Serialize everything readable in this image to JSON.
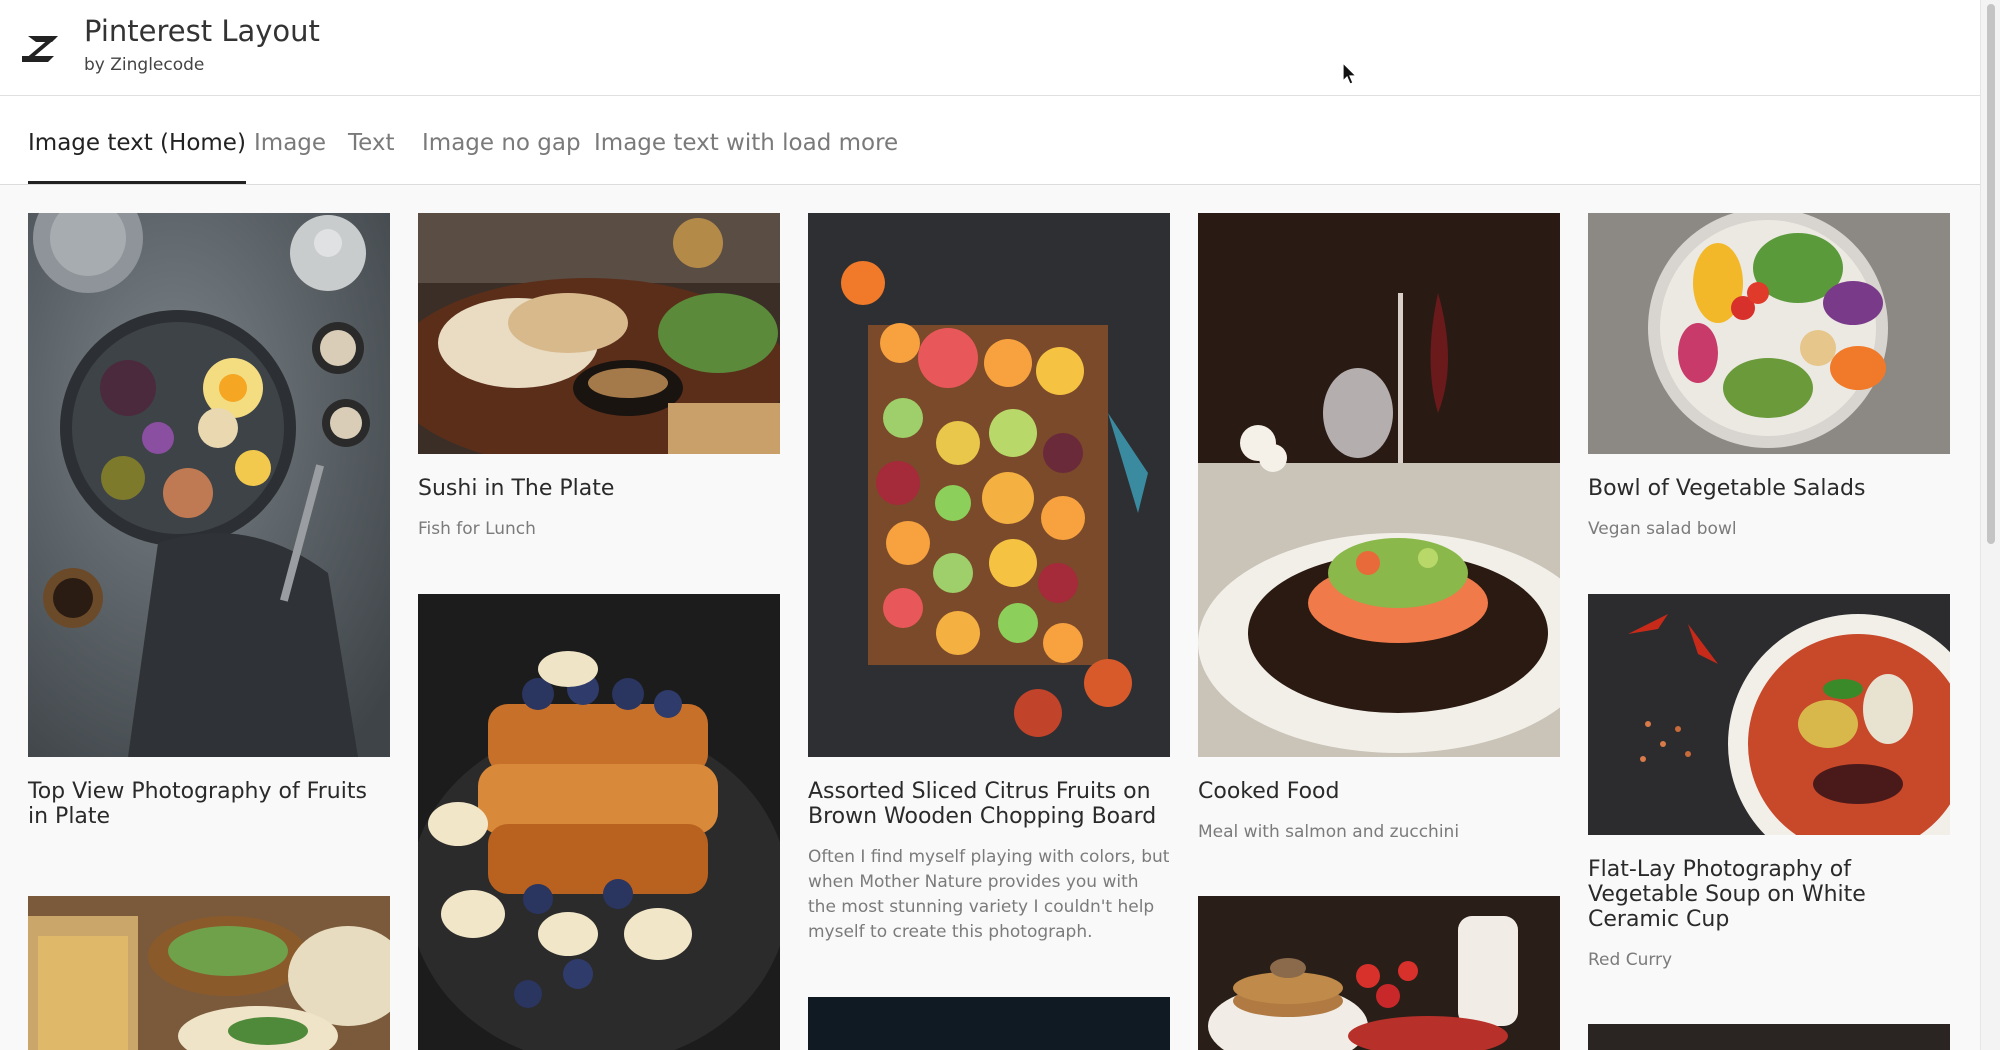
{
  "header": {
    "title": "Pinterest Layout",
    "subtitle": "by Zinglecode",
    "logo_icon": "zinglecode-logo"
  },
  "tabs": [
    {
      "label": "Image text (Home)",
      "active": true
    },
    {
      "label": "Image",
      "active": false
    },
    {
      "label": "Text",
      "active": false
    },
    {
      "label": "Image no gap",
      "active": false
    },
    {
      "label": "Image text with load more",
      "active": false
    }
  ],
  "cards": [
    {
      "title": "Top View Photography of Fruits in Plate",
      "subtitle": ""
    },
    {
      "title": "Sushi in The Plate",
      "subtitle": "Fish for Lunch"
    },
    {
      "title": "Assorted Sliced Citrus Fruits on Brown Wooden Chopping Board",
      "subtitle": "Often I find myself playing with colors, but when Mother Nature provides you with the most stunning variety I couldn't help myself to create this photograph."
    },
    {
      "title": "Cooked Food",
      "subtitle": "Meal with salmon and zucchini"
    },
    {
      "title": "Bowl of Vegetable Salads",
      "subtitle": "Vegan salad bowl"
    },
    {
      "title": "Flat-Lay Photography of Vegetable Soup on White Ceramic Cup",
      "subtitle": "Red Curry"
    }
  ],
  "colors": {
    "accent": "#222222",
    "tab_inactive": "#7a7a7a",
    "background": "#f9f9f9"
  }
}
